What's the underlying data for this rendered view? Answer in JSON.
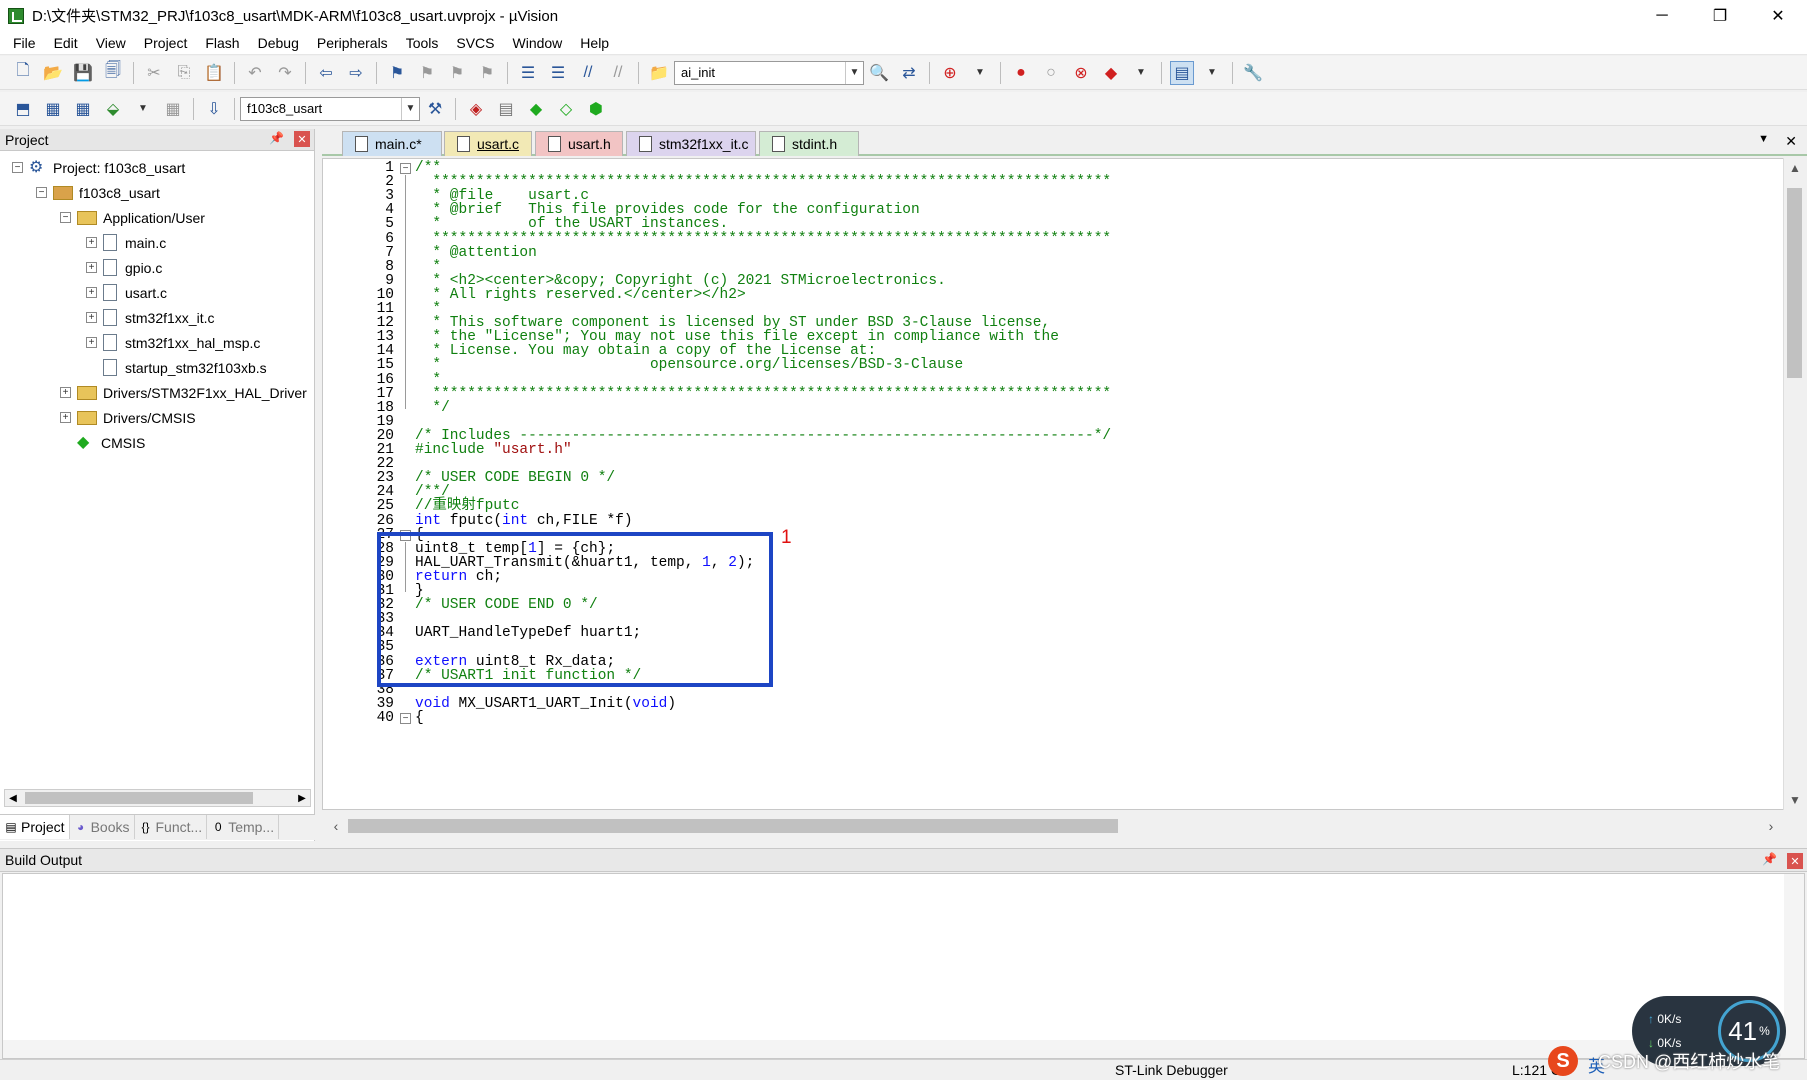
{
  "window": {
    "title": "D:\\文件夹\\STM32_PRJ\\f103c8_usart\\MDK-ARM\\f103c8_usart.uvprojx - µVision",
    "controls": [
      "─",
      "❐",
      "✕"
    ]
  },
  "menu": [
    "File",
    "Edit",
    "View",
    "Project",
    "Flash",
    "Debug",
    "Peripherals",
    "Tools",
    "SVCS",
    "Window",
    "Help"
  ],
  "toolbar1": {
    "find_combo": "ai_init"
  },
  "toolbar2": {
    "target_combo": "f103c8_usart"
  },
  "project_panel": {
    "title": "Project",
    "tree": [
      {
        "label": "Project: f103c8_usart",
        "level": 0,
        "toggle": "−",
        "icon": "project-icon"
      },
      {
        "label": "f103c8_usart",
        "level": 1,
        "toggle": "−",
        "icon": "target-icon"
      },
      {
        "label": "Application/User",
        "level": 2,
        "toggle": "−",
        "icon": "folder-icon"
      },
      {
        "label": "main.c",
        "level": 3,
        "toggle": "+",
        "icon": "file-icon"
      },
      {
        "label": "gpio.c",
        "level": 3,
        "toggle": "+",
        "icon": "file-icon"
      },
      {
        "label": "usart.c",
        "level": 3,
        "toggle": "+",
        "icon": "file-icon"
      },
      {
        "label": "stm32f1xx_it.c",
        "level": 3,
        "toggle": "+",
        "icon": "file-icon"
      },
      {
        "label": "stm32f1xx_hal_msp.c",
        "level": 3,
        "toggle": "+",
        "icon": "file-icon"
      },
      {
        "label": "startup_stm32f103xb.s",
        "level": 3,
        "toggle": "",
        "icon": "file-icon"
      },
      {
        "label": "Drivers/STM32F1xx_HAL_Driver",
        "level": 2,
        "toggle": "+",
        "icon": "folder-icon"
      },
      {
        "label": "Drivers/CMSIS",
        "level": 2,
        "toggle": "+",
        "icon": "folder-icon"
      },
      {
        "label": "CMSIS",
        "level": 2,
        "toggle": "",
        "icon": "gem-icon"
      }
    ],
    "tabs": [
      "Project",
      "Books",
      "Funct...",
      "Temp..."
    ]
  },
  "file_tabs": [
    {
      "label": "main.c*",
      "color": "#cde0f2"
    },
    {
      "label": "usart.c",
      "color": "#f2e9b5"
    },
    {
      "label": "usart.h",
      "color": "#f2c4c4"
    },
    {
      "label": "stm32f1xx_it.c",
      "color": "#dcd4ee"
    },
    {
      "label": "stdint.h",
      "color": "#d4ecd4"
    }
  ],
  "code_lines": [
    [
      [
        "cm",
        "/**"
      ]
    ],
    [
      [
        "cm",
        "  ******************************************************************************"
      ]
    ],
    [
      [
        "cm",
        "  * @file    usart.c"
      ]
    ],
    [
      [
        "cm",
        "  * @brief   This file provides code for the configuration"
      ]
    ],
    [
      [
        "cm",
        "  *          of the USART instances."
      ]
    ],
    [
      [
        "cm",
        "  ******************************************************************************"
      ]
    ],
    [
      [
        "cm",
        "  * @attention"
      ]
    ],
    [
      [
        "cm",
        "  *"
      ]
    ],
    [
      [
        "cm",
        "  * <h2><center>&copy; Copyright (c) 2021 STMicroelectronics."
      ]
    ],
    [
      [
        "cm",
        "  * All rights reserved.</center></h2>"
      ]
    ],
    [
      [
        "cm",
        "  *"
      ]
    ],
    [
      [
        "cm",
        "  * This software component is licensed by ST under BSD 3-Clause license,"
      ]
    ],
    [
      [
        "cm",
        "  * the \"License\"; You may not use this file except in compliance with the"
      ]
    ],
    [
      [
        "cm",
        "  * License. You may obtain a copy of the License at:"
      ]
    ],
    [
      [
        "cm",
        "  *                        opensource.org/licenses/BSD-3-Clause"
      ]
    ],
    [
      [
        "cm",
        "  *"
      ]
    ],
    [
      [
        "cm",
        "  ******************************************************************************"
      ]
    ],
    [
      [
        "cm",
        "  */"
      ]
    ],
    [],
    [
      [
        "cm",
        "/* Includes ------------------------------------------------------------------*/"
      ]
    ],
    [
      [
        "cm",
        "#include "
      ],
      [
        "st",
        "\"usart.h\""
      ]
    ],
    [],
    [
      [
        "cm",
        "/* USER CODE BEGIN 0 */"
      ]
    ],
    [
      [
        "cm",
        "/**/"
      ]
    ],
    [
      [
        "cm",
        "//重映射fputc"
      ]
    ],
    [
      [
        "kw",
        "int"
      ],
      [
        "pl",
        " fputc("
      ],
      [
        "kw",
        "int"
      ],
      [
        "pl",
        " ch,FILE *f)"
      ]
    ],
    [
      [
        "pl",
        "{"
      ]
    ],
    [
      [
        "pl",
        "uint8_t temp["
      ],
      [
        "nm",
        "1"
      ],
      [
        "pl",
        "] = {ch};"
      ]
    ],
    [
      [
        "pl",
        "HAL_UART_Transmit(&huart1, temp, "
      ],
      [
        "nm",
        "1"
      ],
      [
        "pl",
        ", "
      ],
      [
        "nm",
        "2"
      ],
      [
        "pl",
        ");"
      ]
    ],
    [
      [
        "kw",
        "return"
      ],
      [
        "pl",
        " ch;"
      ]
    ],
    [
      [
        "pl",
        "}"
      ]
    ],
    [
      [
        "cm",
        "/* USER CODE END 0 */"
      ]
    ],
    [],
    [
      [
        "pl",
        "UART_HandleTypeDef huart1;"
      ]
    ],
    [],
    [
      [
        "kw",
        "extern"
      ],
      [
        "pl",
        " uint8_t Rx_data;"
      ]
    ],
    [
      [
        "cm",
        "/* USART1 init function */"
      ]
    ],
    [],
    [
      [
        "kw",
        "void"
      ],
      [
        "pl",
        " MX_USART1_UART_Init("
      ],
      [
        "kw",
        "void"
      ],
      [
        "pl",
        ")"
      ]
    ],
    [
      [
        "pl",
        "{"
      ]
    ]
  ],
  "annotation_label": "1",
  "build_output": {
    "title": "Build Output"
  },
  "status": {
    "debugger": "ST-Link Debugger",
    "position": "L:121 C"
  },
  "overlay": {
    "net_up": "0K/s",
    "net_down": "0K/s",
    "cpu_percent": "41",
    "cpu_unit": "%",
    "watermark": "CSDN @西红柿炒水笔",
    "csdn_logo": "S",
    "ime": "英"
  }
}
